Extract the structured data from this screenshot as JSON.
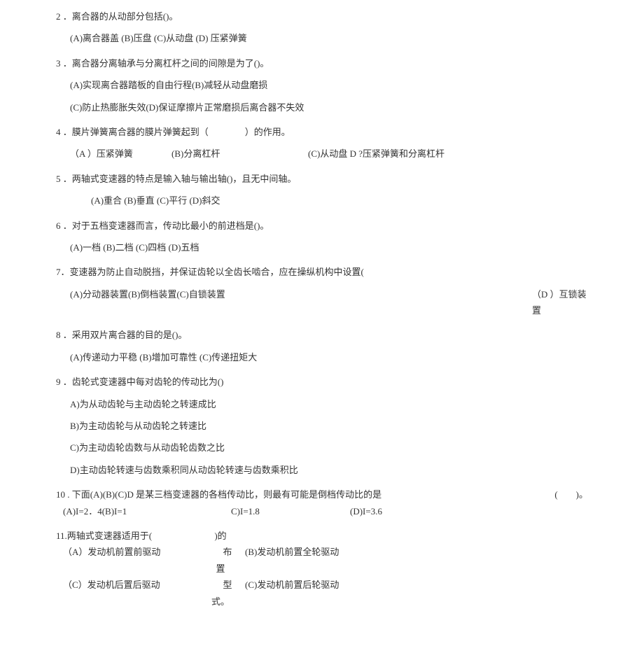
{
  "q2": {
    "stem": "2 ．离合器的从动部分包括()。",
    "options": "(A)离合器盖 (B)压盘 (C)从动盘 (D) 压紧弹簧"
  },
  "q3": {
    "stem": "3 ．离合器分离轴承与分离杠杆之间的间隙是为了()。",
    "options1": "(A)实现离合器踏板的自由行程(B)减轻从动盘磨损",
    "options2": "(C)防止热膨胀失效(D)保证摩擦片正常磨损后离合器不失效"
  },
  "q4": {
    "stem": "4 ．膜片弹簧离合器的膜片弹簧起到（　　　　）的作用。",
    "a": "（A ）压紧弹簧",
    "b": "(B)分离杠杆",
    "c": "(C)从动盘 D ?压紧弹簧和分离杠杆"
  },
  "q5": {
    "stem": "5 ．两轴式变速器的特点是输入轴与输出轴()，且无中间轴。",
    "options": "(A)重合 (B)垂直 (C)平行 (D)斜交"
  },
  "q6": {
    "stem": "6 ．对于五档变速器而言，传动比最小的前进档是()。",
    "options": "(A)一档 (B)二档 (C)四档 (D)五档"
  },
  "q7": {
    "stem": "7．变速器为防止自动脱挡，并保证齿轮以全齿长啮合，应在操纵机构中设置(",
    "options": "(A)分动器装置(B)倒档装置(C)自锁装置",
    "d": "（D ）互锁装置"
  },
  "q8": {
    "stem": "8 ．采用双片离合器的目的是()。",
    "options": "(A)传递动力平稳 (B)增加可靠性 (C)传递扭矩大"
  },
  "q9": {
    "stem": "9 ．齿轮式变速器中每对齿轮的传动比为()",
    "a": "A)为从动齿轮与主动齿轮之转速成比",
    "b": "B)为主动齿轮与从动齿轮之转速比",
    "c": "C)为主动齿轮齿数与从动齿轮齿数之比",
    "d": "D)主动齿轮转速与齿数乘积同从动齿轮转速与齿数乘积比"
  },
  "q10": {
    "stem": "10 . 下面(A)(B)(C)D 是某三档变速器的各档传动比，则最有可能是倒档传动比的是",
    "blank": "(　　)。",
    "ab": "(A)I=2．4(B)I=1",
    "c": "C)I=1.8",
    "d": "(D)I=3.6"
  },
  "q11": {
    "stem_left": "11.两轴式变速器适用于(",
    "stem_right_top": ")的",
    "mid1": "布",
    "mid2": "置",
    "mid3": "型",
    "mid4": "式。",
    "a": "（A）发动机前置前驱动",
    "b": "(B)发动机前置全轮驱动",
    "c": "（C）发动机后置后驱动",
    "d": "(C)发动机前置后轮驱动"
  }
}
